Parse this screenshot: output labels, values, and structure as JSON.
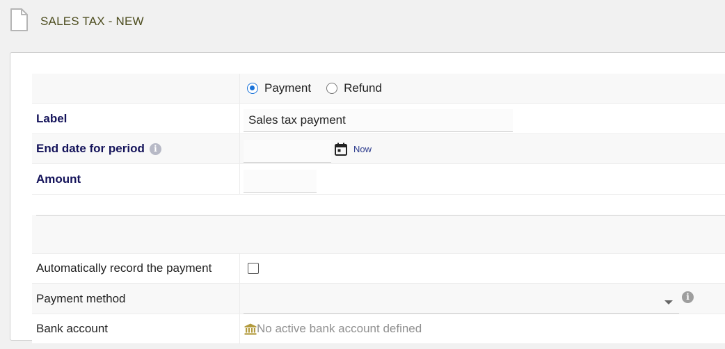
{
  "header": {
    "title": "SALES TAX - NEW",
    "icon": "document-icon"
  },
  "form": {
    "type": {
      "options": [
        {
          "label": "Payment",
          "selected": true
        },
        {
          "label": "Refund",
          "selected": false
        }
      ]
    },
    "label": {
      "caption": "Label",
      "value": "Sales tax payment"
    },
    "end_date": {
      "caption": "End date for period",
      "value": "",
      "now_link": "Now"
    },
    "amount": {
      "caption": "Amount",
      "value": ""
    },
    "auto_record": {
      "caption": "Automatically record the payment",
      "checked": false
    },
    "payment_method": {
      "caption": "Payment method",
      "value": ""
    },
    "bank_account": {
      "caption": "Bank account",
      "value": "No active bank account defined"
    }
  },
  "colors": {
    "accent": "#1a73d9",
    "label_bold": "#14135a",
    "title": "#4d4d1f",
    "bank_icon": "#b39b3e"
  }
}
